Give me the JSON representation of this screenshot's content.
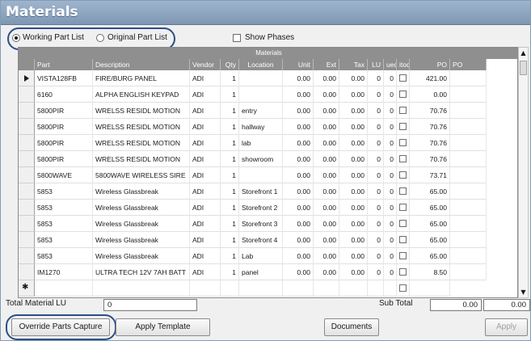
{
  "window": {
    "title": "Materials"
  },
  "options": {
    "working_part_list": "Working Part List",
    "original_part_list": "Original Part List",
    "show_phases": "Show Phases"
  },
  "grid": {
    "caption": "Materials",
    "columns": [
      "Part",
      "Description",
      "Vendor",
      "Qty",
      "Location",
      "Unit",
      "Ext",
      "Tax",
      "LU",
      "ued",
      "itod",
      "PO",
      "PO"
    ],
    "rows": [
      {
        "part": "VISTA128FB",
        "description": "FIRE/BURG PANEL",
        "vendor": "ADI",
        "qty": "1",
        "location": "",
        "unit": "0.00",
        "ext": "0.00",
        "tax": "0.00",
        "lu": "0",
        "ued": "0",
        "po": "421.00"
      },
      {
        "part": "6160",
        "description": "ALPHA ENGLISH KEYPAD",
        "vendor": "ADI",
        "qty": "1",
        "location": "",
        "unit": "0.00",
        "ext": "0.00",
        "tax": "0.00",
        "lu": "0",
        "ued": "0",
        "po": "0.00"
      },
      {
        "part": "5800PIR",
        "description": "WRELSS RESIDL MOTION",
        "vendor": "ADI",
        "qty": "1",
        "location": "entry",
        "unit": "0.00",
        "ext": "0.00",
        "tax": "0.00",
        "lu": "0",
        "ued": "0",
        "po": "70.76"
      },
      {
        "part": "5800PIR",
        "description": "WRELSS RESIDL MOTION",
        "vendor": "ADI",
        "qty": "1",
        "location": "hallway",
        "unit": "0.00",
        "ext": "0.00",
        "tax": "0.00",
        "lu": "0",
        "ued": "0",
        "po": "70.76"
      },
      {
        "part": "5800PIR",
        "description": "WRELSS RESIDL MOTION",
        "vendor": "ADI",
        "qty": "1",
        "location": "lab",
        "unit": "0.00",
        "ext": "0.00",
        "tax": "0.00",
        "lu": "0",
        "ued": "0",
        "po": "70.76"
      },
      {
        "part": "5800PIR",
        "description": "WRELSS RESIDL MOTION",
        "vendor": "ADI",
        "qty": "1",
        "location": "showroom",
        "unit": "0.00",
        "ext": "0.00",
        "tax": "0.00",
        "lu": "0",
        "ued": "0",
        "po": "70.76"
      },
      {
        "part": "5800WAVE",
        "description": "5800WAVE WIRELESS SIRE",
        "vendor": "ADI",
        "qty": "1",
        "location": "",
        "unit": "0.00",
        "ext": "0.00",
        "tax": "0.00",
        "lu": "0",
        "ued": "0",
        "po": "73.71"
      },
      {
        "part": "5853",
        "description": "Wireless Glassbreak",
        "vendor": "ADI",
        "qty": "1",
        "location": "Storefront 1",
        "unit": "0.00",
        "ext": "0.00",
        "tax": "0.00",
        "lu": "0",
        "ued": "0",
        "po": "65.00"
      },
      {
        "part": "5853",
        "description": "Wireless Glassbreak",
        "vendor": "ADI",
        "qty": "1",
        "location": "Storefront 2",
        "unit": "0.00",
        "ext": "0.00",
        "tax": "0.00",
        "lu": "0",
        "ued": "0",
        "po": "65.00"
      },
      {
        "part": "5853",
        "description": "Wireless Glassbreak",
        "vendor": "ADI",
        "qty": "1",
        "location": "Storefront 3",
        "unit": "0.00",
        "ext": "0.00",
        "tax": "0.00",
        "lu": "0",
        "ued": "0",
        "po": "65.00"
      },
      {
        "part": "5853",
        "description": "Wireless Glassbreak",
        "vendor": "ADI",
        "qty": "1",
        "location": "Storefront 4",
        "unit": "0.00",
        "ext": "0.00",
        "tax": "0.00",
        "lu": "0",
        "ued": "0",
        "po": "65.00"
      },
      {
        "part": "5853",
        "description": "Wireless Glassbreak",
        "vendor": "ADI",
        "qty": "1",
        "location": "Lab",
        "unit": "0.00",
        "ext": "0.00",
        "tax": "0.00",
        "lu": "0",
        "ued": "0",
        "po": "65.00"
      },
      {
        "part": "IM1270",
        "description": "ULTRA TECH 12V 7AH BATT",
        "vendor": "ADI",
        "qty": "1",
        "location": "panel",
        "unit": "0.00",
        "ext": "0.00",
        "tax": "0.00",
        "lu": "0",
        "ued": "0",
        "po": "8.50"
      }
    ]
  },
  "footer": {
    "total_material_lu_label": "Total Material LU",
    "total_material_lu_value": "0",
    "sub_total_label": "Sub Total",
    "sub_total_value": "0.00",
    "sub_total_value_2": "0.00"
  },
  "buttons": {
    "override": "Override Parts Capture",
    "apply_template": "Apply Template",
    "documents": "Documents",
    "apply": "Apply"
  },
  "colors": {
    "title_bar": "#8aa2bd",
    "highlight_oval": "#2b4f86",
    "grid_header": "#8f8f8f"
  }
}
